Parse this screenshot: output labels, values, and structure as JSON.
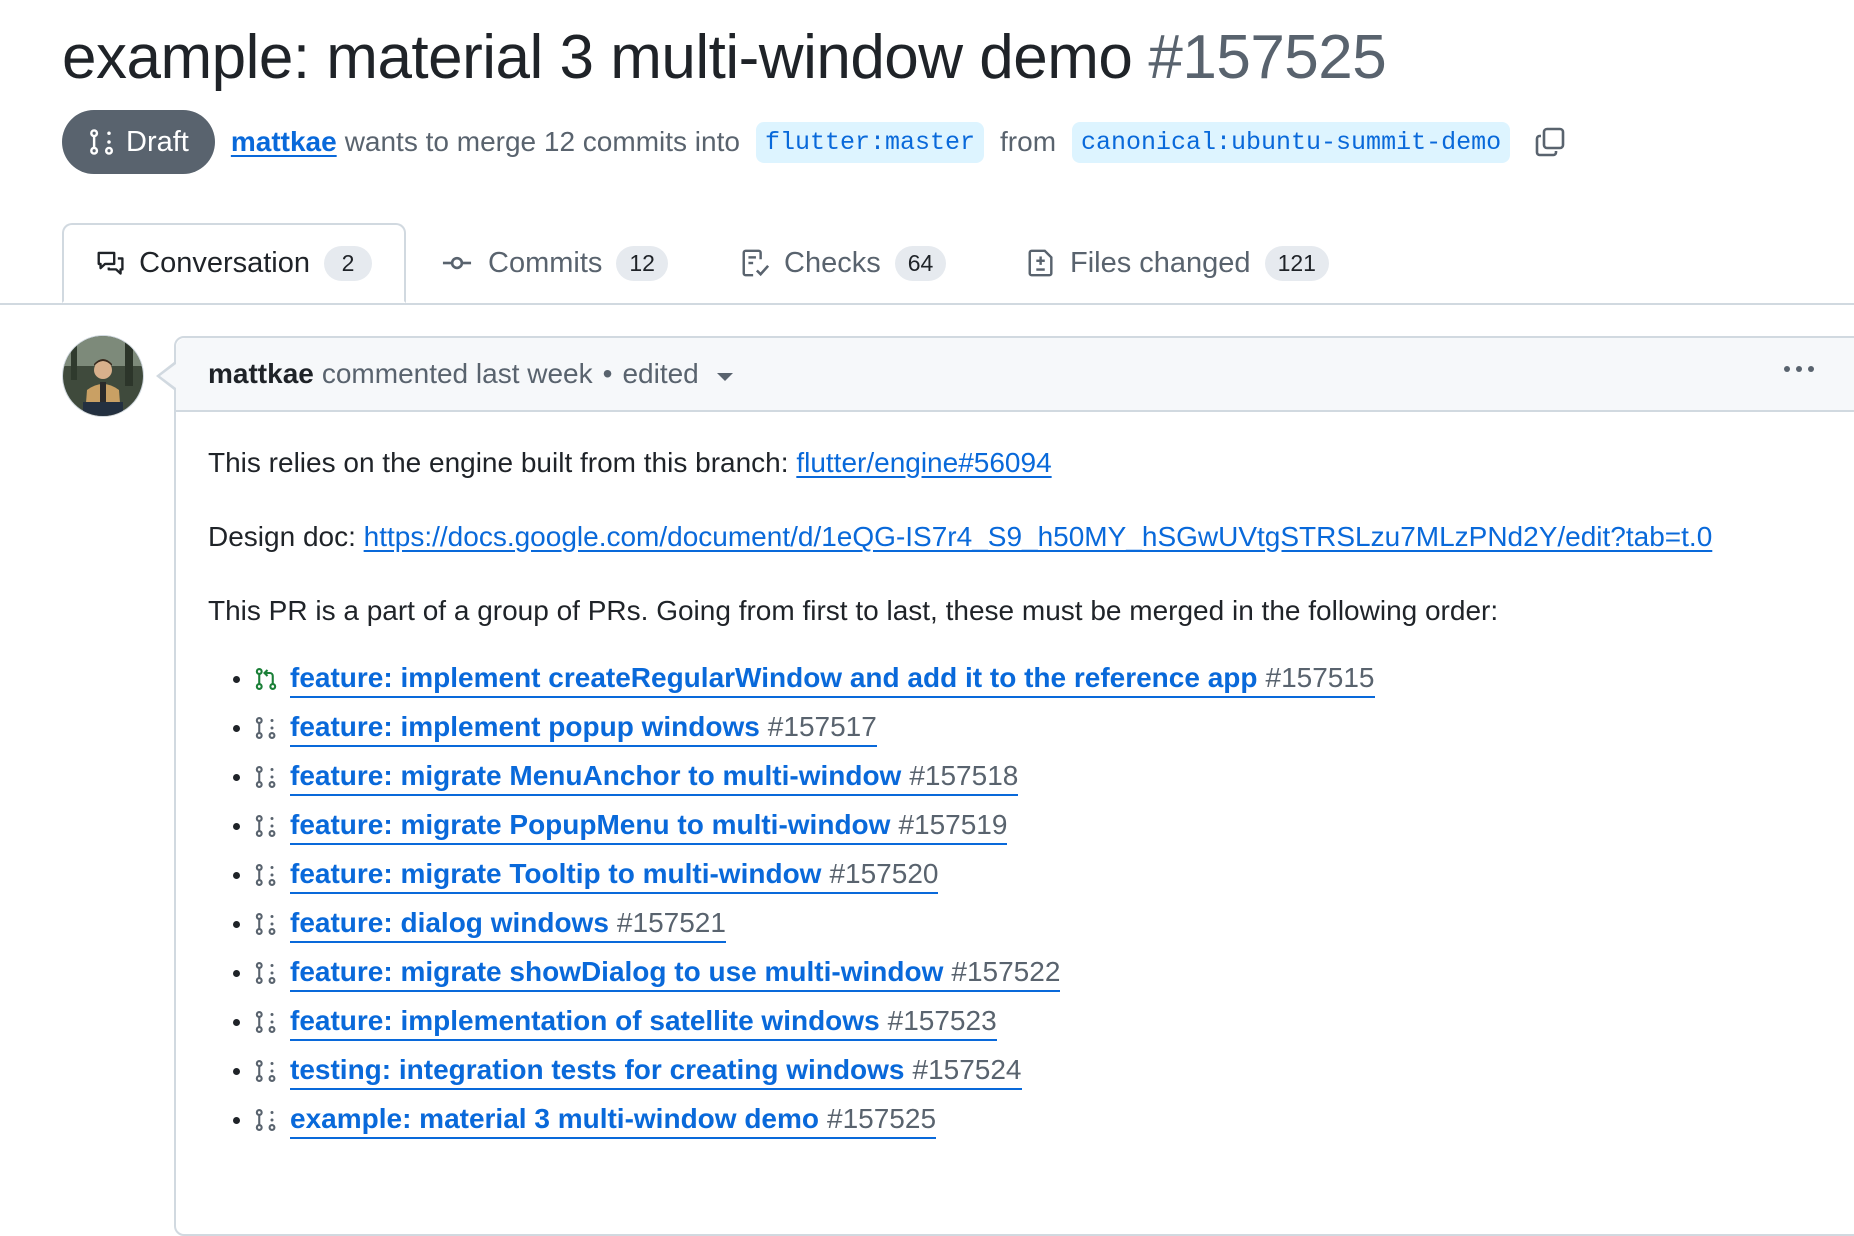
{
  "title": {
    "text": "example: material 3 multi-window demo",
    "number": "#157525"
  },
  "status": {
    "label": "Draft",
    "icon": "git-pull-request-draft-icon"
  },
  "meta": {
    "author": "mattkae",
    "merge_text": "wants to merge 12 commits into",
    "base_branch": "flutter:master",
    "from_text": "from",
    "head_branch": "canonical:ubuntu-summit-demo",
    "copy_icon": "copy-icon"
  },
  "tabs": [
    {
      "label": "Conversation",
      "count": "2",
      "icon": "comment-discussion-icon",
      "active": true
    },
    {
      "label": "Commits",
      "count": "12",
      "icon": "git-commit-icon"
    },
    {
      "label": "Checks",
      "count": "64",
      "icon": "checklist-icon"
    },
    {
      "label": "Files changed",
      "count": "121",
      "icon": "file-diff-icon"
    }
  ],
  "comment": {
    "author": "mattkae",
    "action": "commented last week",
    "separator": "•",
    "edited": "edited",
    "body": {
      "p1_text": "This relies on the engine built from this branch: ",
      "p1_link": "flutter/engine#56094",
      "p2_text": "Design doc: ",
      "p2_link": "https://docs.google.com/document/d/1eQG-IS7r4_S9_h50MY_hSGwUVtgSTRSLzu7MLzPNd2Y/edit?tab=t.0",
      "p3_text": "This PR is a part of a group of PRs. Going from first to last, these must be merged in the following order:"
    },
    "pr_list": [
      {
        "title": "feature: implement createRegularWindow and add it to the reference app",
        "number": "#157515",
        "icon": "git-pull-request-open-icon"
      },
      {
        "title": "feature: implement popup windows",
        "number": "#157517",
        "icon": "git-pull-request-draft-icon"
      },
      {
        "title": "feature: migrate MenuAnchor to multi-window",
        "number": "#157518",
        "icon": "git-pull-request-draft-icon"
      },
      {
        "title": "feature: migrate PopupMenu to multi-window",
        "number": "#157519",
        "icon": "git-pull-request-draft-icon"
      },
      {
        "title": "feature: migrate Tooltip to multi-window",
        "number": "#157520",
        "icon": "git-pull-request-draft-icon"
      },
      {
        "title": "feature: dialog windows",
        "number": "#157521",
        "icon": "git-pull-request-draft-icon"
      },
      {
        "title": "feature: migrate showDialog to use multi-window",
        "number": "#157522",
        "icon": "git-pull-request-draft-icon"
      },
      {
        "title": "feature: implementation of satellite windows",
        "number": "#157523",
        "icon": "git-pull-request-draft-icon"
      },
      {
        "title": "testing: integration tests for creating windows",
        "number": "#157524",
        "icon": "git-pull-request-draft-icon"
      },
      {
        "title": "example: material 3 multi-window demo",
        "number": "#157525",
        "icon": "git-pull-request-draft-icon"
      }
    ]
  },
  "colors": {
    "link": "#0969da",
    "draft_badge": "#59636e",
    "open_icon": "#1a7f37",
    "muted": "#59636e"
  }
}
